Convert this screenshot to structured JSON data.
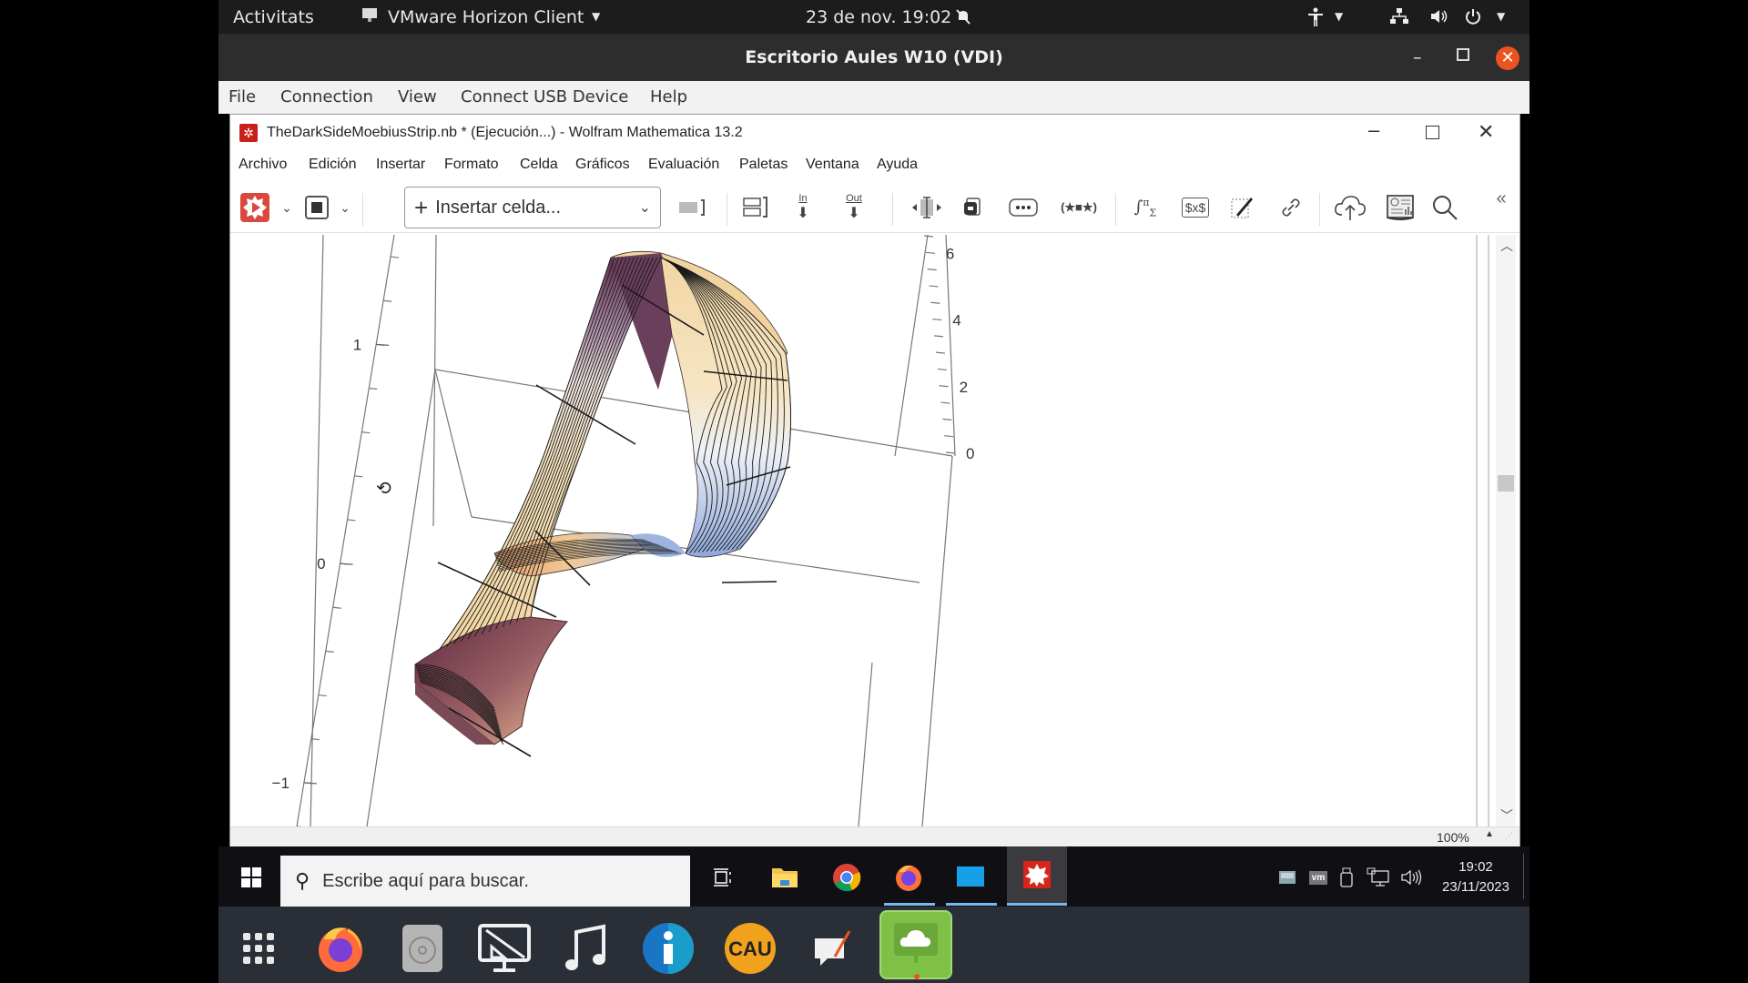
{
  "ubuntu_topbar": {
    "activities": "Activitats",
    "app_menu": "VMware Horizon Client",
    "datetime": "23 de nov.  19:02",
    "icons": [
      "accessibility-icon",
      "network-icon",
      "volume-icon",
      "power-icon"
    ]
  },
  "vmware": {
    "title": "Escritorio Aules W10 (VDI)",
    "menu": [
      "File",
      "Connection",
      "View",
      "Connect USB Device",
      "Help"
    ],
    "close_color": "#e95420"
  },
  "mathematica": {
    "title": "TheDarkSideMoebiusStrip.nb * (Ejecución...) - Wolfram Mathematica 13.2",
    "menu": [
      "Archivo",
      "Edición",
      "Insertar",
      "Formato",
      "Celda",
      "Gráficos",
      "Evaluación",
      "Paletas",
      "Ventana",
      "Ayuda"
    ],
    "toolbar": {
      "insert_cell_label": "Insertar celda...",
      "in_label": "In",
      "out_label": "Out",
      "dollar_label": "$x$",
      "icons": [
        "evaluate-icon",
        "abort-icon",
        "cell-group-icon",
        "cell-bracket-icon",
        "insert-in-icon",
        "insert-out-icon",
        "resize-icon",
        "frame-icon",
        "ellipsis-icon",
        "expression-icon",
        "math-palette-icon",
        "tex-icon",
        "drawing-icon",
        "link-icon",
        "cloud-upload-icon",
        "documentation-icon",
        "search-icon",
        "collapse-icon"
      ]
    },
    "zoom_level": "100%",
    "accent": "#dd1100"
  },
  "chart_data": {
    "type": "surface3d",
    "title": "",
    "description": "Parametric 3D plot of a Moebius strip with mesh lines, colored with a purple-to-beige-to-blue gradient",
    "axes": {
      "vertical_left": {
        "ticks": [
          "1",
          "0",
          "-1"
        ],
        "range": [
          -1.2,
          1.5
        ]
      },
      "right": {
        "ticks": [
          "6",
          "4",
          "2",
          "0"
        ],
        "range": [
          0,
          6.5
        ]
      }
    },
    "grid": false,
    "colors": [
      "#5e2e4a",
      "#a87f9c",
      "#f6deb0",
      "#f5e6c8",
      "#9fb4e0"
    ]
  },
  "windows_taskbar": {
    "search_placeholder": "Escribe aquí para buscar.",
    "apps": [
      "task-view",
      "file-explorer",
      "chrome",
      "firefox",
      "vmware",
      "mathematica"
    ],
    "time": "19:02",
    "date": "23/11/2023"
  },
  "dock": {
    "apps": [
      "show-apps",
      "firefox",
      "optical-drive",
      "remote-desktop",
      "music",
      "info",
      "cau",
      "text-editor",
      "horizon-client"
    ]
  }
}
